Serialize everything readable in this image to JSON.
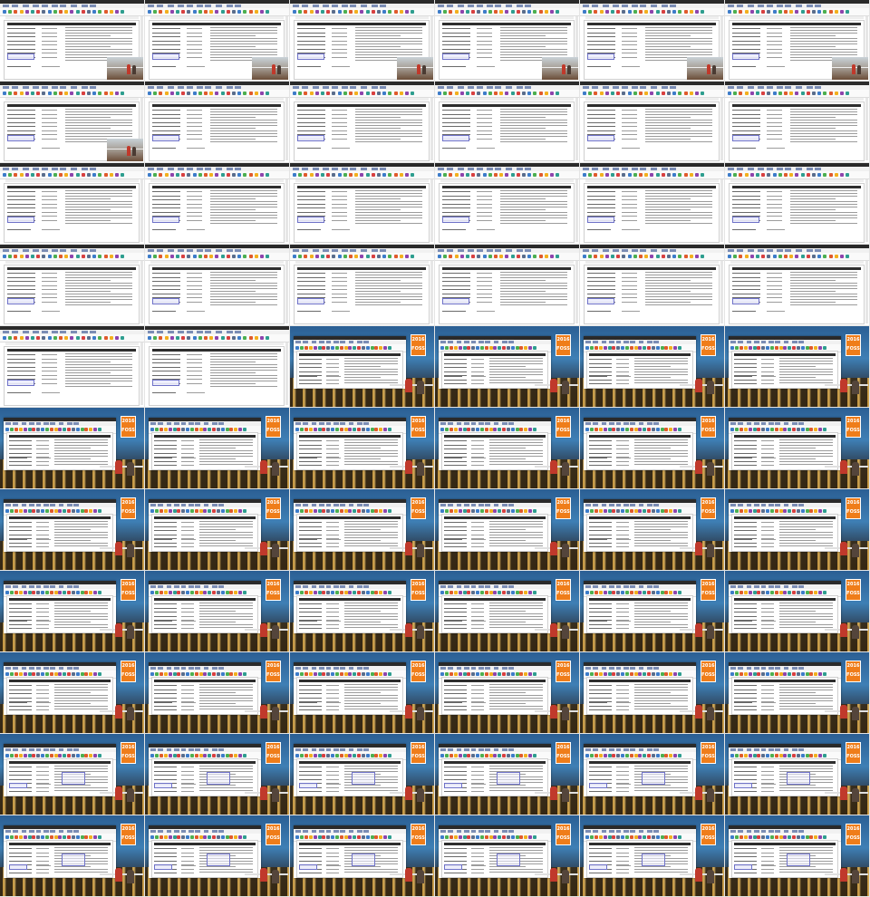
{
  "sheet": {
    "columns": 6,
    "rows": 11,
    "tiles": [
      {
        "view": "doc",
        "photo": true,
        "highlight": false
      },
      {
        "view": "doc",
        "photo": true,
        "highlight": false
      },
      {
        "view": "doc",
        "photo": true,
        "highlight": false
      },
      {
        "view": "doc",
        "photo": true,
        "highlight": false
      },
      {
        "view": "doc",
        "photo": true,
        "highlight": false
      },
      {
        "view": "doc",
        "photo": true,
        "highlight": false
      },
      {
        "view": "doc",
        "photo": true,
        "highlight": false
      },
      {
        "view": "doc",
        "photo": false,
        "highlight": false
      },
      {
        "view": "doc",
        "photo": false,
        "highlight": false
      },
      {
        "view": "doc",
        "photo": false,
        "highlight": false
      },
      {
        "view": "doc",
        "photo": false,
        "highlight": false
      },
      {
        "view": "doc",
        "photo": false,
        "highlight": false
      },
      {
        "view": "doc",
        "photo": false,
        "highlight": false
      },
      {
        "view": "doc",
        "photo": false,
        "highlight": false
      },
      {
        "view": "doc",
        "photo": false,
        "highlight": false
      },
      {
        "view": "doc",
        "photo": false,
        "highlight": false
      },
      {
        "view": "doc",
        "photo": false,
        "highlight": false
      },
      {
        "view": "doc",
        "photo": false,
        "highlight": false
      },
      {
        "view": "doc",
        "photo": false,
        "highlight": false
      },
      {
        "view": "doc",
        "photo": false,
        "highlight": false
      },
      {
        "view": "doc",
        "photo": false,
        "highlight": false
      },
      {
        "view": "doc",
        "photo": false,
        "highlight": false
      },
      {
        "view": "doc",
        "photo": false,
        "highlight": false
      },
      {
        "view": "doc",
        "photo": false,
        "highlight": false
      },
      {
        "view": "doc",
        "photo": false,
        "highlight": false
      },
      {
        "view": "doc",
        "photo": false,
        "highlight": false
      },
      {
        "view": "screen",
        "speakers": true,
        "highlight": false
      },
      {
        "view": "screen",
        "speakers": true,
        "highlight": false
      },
      {
        "view": "screen",
        "speakers": true,
        "highlight": false
      },
      {
        "view": "screen",
        "speakers": true,
        "highlight": false
      },
      {
        "view": "screen",
        "speakers": true,
        "highlight": false
      },
      {
        "view": "screen",
        "speakers": true,
        "highlight": false
      },
      {
        "view": "screen",
        "speakers": true,
        "highlight": false
      },
      {
        "view": "screen",
        "speakers": true,
        "highlight": false
      },
      {
        "view": "screen",
        "speakers": true,
        "highlight": false
      },
      {
        "view": "screen",
        "speakers": true,
        "highlight": false
      },
      {
        "view": "screen",
        "speakers": true,
        "highlight": false
      },
      {
        "view": "screen",
        "speakers": true,
        "highlight": false
      },
      {
        "view": "screen",
        "speakers": true,
        "highlight": false
      },
      {
        "view": "screen",
        "speakers": true,
        "highlight": false
      },
      {
        "view": "screen",
        "speakers": true,
        "highlight": false
      },
      {
        "view": "screen",
        "speakers": true,
        "highlight": false
      },
      {
        "view": "screen",
        "speakers": true,
        "highlight": false
      },
      {
        "view": "screen",
        "speakers": true,
        "highlight": false
      },
      {
        "view": "screen",
        "speakers": true,
        "highlight": false
      },
      {
        "view": "screen",
        "speakers": true,
        "highlight": false
      },
      {
        "view": "screen",
        "speakers": true,
        "highlight": false
      },
      {
        "view": "screen",
        "speakers": true,
        "highlight": false
      },
      {
        "view": "screen",
        "speakers": true,
        "highlight": false
      },
      {
        "view": "screen",
        "speakers": true,
        "highlight": false
      },
      {
        "view": "screen",
        "speakers": true,
        "highlight": false
      },
      {
        "view": "screen",
        "speakers": true,
        "highlight": false
      },
      {
        "view": "screen",
        "speakers": true,
        "highlight": false
      },
      {
        "view": "screen",
        "speakers": true,
        "highlight": false
      },
      {
        "view": "screen",
        "speakers": true,
        "highlight": true
      },
      {
        "view": "screen",
        "speakers": true,
        "highlight": true
      },
      {
        "view": "screen",
        "speakers": true,
        "highlight": true
      },
      {
        "view": "screen",
        "speakers": true,
        "highlight": true
      },
      {
        "view": "screen",
        "speakers": true,
        "highlight": true
      },
      {
        "view": "screen",
        "speakers": true,
        "highlight": true
      },
      {
        "view": "screen",
        "speakers": true,
        "highlight": true
      },
      {
        "view": "screen",
        "speakers": true,
        "highlight": true
      },
      {
        "view": "screen",
        "speakers": true,
        "highlight": true
      },
      {
        "view": "screen",
        "speakers": true,
        "highlight": true
      },
      {
        "view": "screen",
        "speakers": true,
        "highlight": true
      },
      {
        "view": "screen",
        "speakers": true,
        "highlight": true
      }
    ]
  },
  "logo": {
    "year": "2016",
    "name": "FOSS"
  },
  "colors": {
    "logo": "#ef7d1a",
    "highlight": "#6f72c8",
    "sky": "#3e7fb5"
  },
  "icons": [
    "menu-bar",
    "toolbar-icons",
    "document-page",
    "speaker-photo",
    "conference-logo"
  ]
}
